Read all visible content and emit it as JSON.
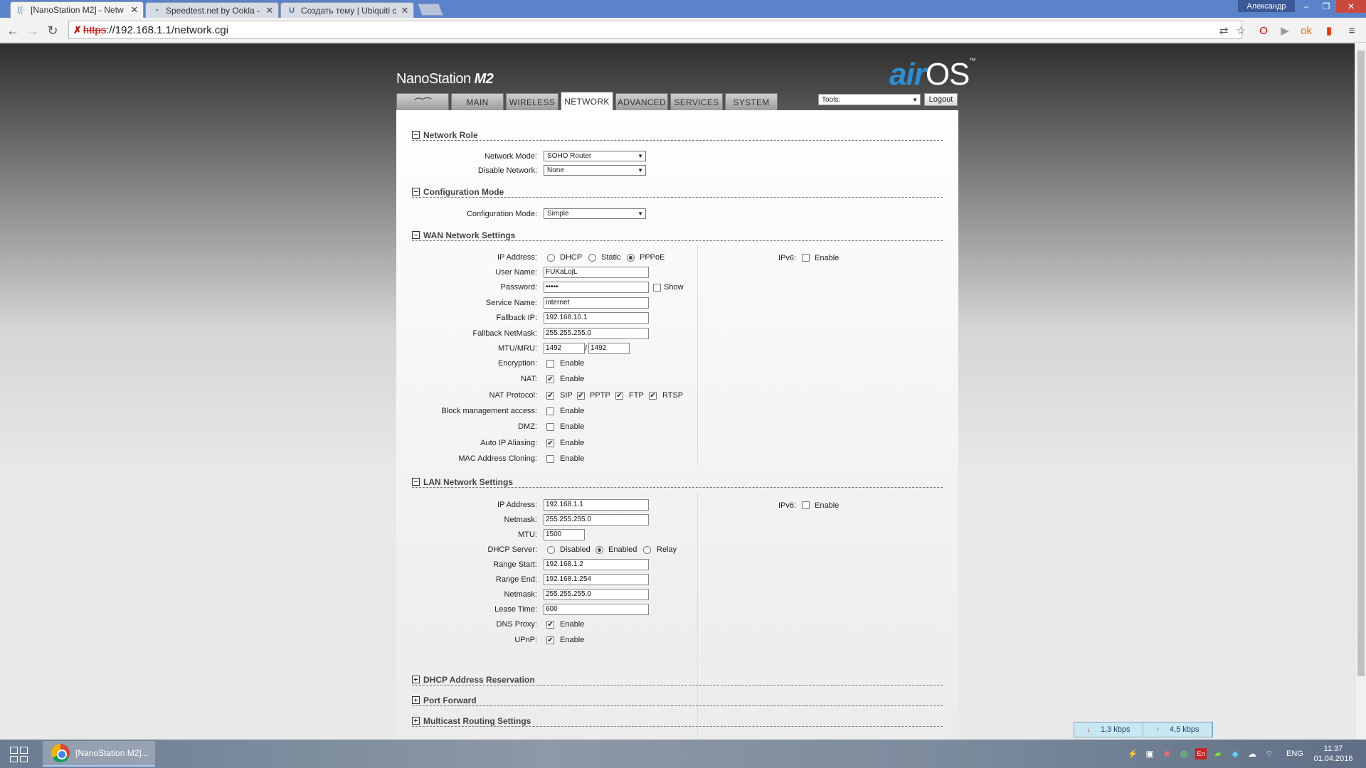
{
  "browser": {
    "tabs": [
      {
        "label": "[NanoStation M2] - Netw",
        "icon": "wifi-icon",
        "active": true
      },
      {
        "label": "Speedtest.net by Ookla -",
        "icon": "speedometer-icon",
        "active": false
      },
      {
        "label": "Создать тему | Ubiquiti c",
        "icon": "ubiquiti-u-icon",
        "active": false
      }
    ],
    "tab_close": "✕",
    "window_user": "Александр",
    "url_scheme": "https",
    "url_rest": "://192.168.1.1/network.cgi"
  },
  "header": {
    "device_name": "NanoStation",
    "device_model": "M2",
    "logo_air": "air",
    "logo_os": "OS",
    "logo_tm": "™",
    "nav": [
      {
        "label": "",
        "icon": "ubiquiti-logo-icon"
      },
      {
        "label": "MAIN"
      },
      {
        "label": "WIRELESS"
      },
      {
        "label": "NETWORK",
        "active": true
      },
      {
        "label": "ADVANCED"
      },
      {
        "label": "SERVICES"
      },
      {
        "label": "SYSTEM"
      }
    ],
    "tools_value": "Tools:",
    "logout_label": "Logout"
  },
  "network_role": {
    "title": "Network Role",
    "network_mode_label": "Network Mode:",
    "network_mode_value": "SOHO Router",
    "disable_network_label": "Disable Network:",
    "disable_network_value": "None"
  },
  "config_mode": {
    "title": "Configuration Mode",
    "label": "Configuration Mode:",
    "value": "Simple"
  },
  "wan": {
    "title": "WAN Network Settings",
    "ip_label": "IP Address:",
    "ip_options": [
      "DHCP",
      "Static",
      "PPPoE"
    ],
    "ip_selected": "PPPoE",
    "ipv6_label": "IPv6:",
    "ipv6_enable": "Enable",
    "username_label": "User Name:",
    "username_value": "FUKaLojL",
    "password_label": "Password:",
    "password_value": "•••••",
    "show_label": "Show",
    "service_label": "Service Name:",
    "service_value": "internet",
    "fallback_ip_label": "Fallback IP:",
    "fallback_ip_value": "192.168.10.1",
    "fallback_mask_label": "Fallback NetMask:",
    "fallback_mask_value": "255.255.255.0",
    "mtu_label": "MTU/MRU:",
    "mtu_value": "1492",
    "mtu_sep": "/",
    "mru_value": "1492",
    "encryption_label": "Encryption:",
    "nat_label": "NAT:",
    "nat_protocol_label": "NAT Protocol:",
    "nat_protocols": [
      "SIP",
      "PPTP",
      "FTP",
      "RTSP"
    ],
    "block_mgmt_label": "Block management access:",
    "dmz_label": "DMZ:",
    "auto_ip_label": "Auto IP Aliasing:",
    "mac_clone_label": "MAC Address Cloning:",
    "enable": "Enable"
  },
  "lan": {
    "title": "LAN Network Settings",
    "ip_label": "IP Address:",
    "ip_value": "192.168.1.1",
    "ipv6_label": "IPv6:",
    "ipv6_enable": "Enable",
    "netmask_label": "Netmask:",
    "netmask_value": "255.255.255.0",
    "mtu_label": "MTU:",
    "mtu_value": "1500",
    "dhcp_label": "DHCP Server:",
    "dhcp_options": [
      "Disabled",
      "Enabled",
      "Relay"
    ],
    "dhcp_selected": "Enabled",
    "range_start_label": "Range Start:",
    "range_start_value": "192.168.1.2",
    "range_end_label": "Range End:",
    "range_end_value": "192.168.1.254",
    "dhcp_netmask_label": "Netmask:",
    "dhcp_netmask_value": "255.255.255.0",
    "lease_label": "Lease Time:",
    "lease_value": "600",
    "dns_proxy_label": "DNS Proxy:",
    "upnp_label": "UPnP:",
    "enable": "Enable"
  },
  "collapsed_sections": [
    "DHCP Address Reservation",
    "Port Forward",
    "Multicast Routing Settings"
  ],
  "netmeter": {
    "down": "1,3 kbps",
    "up": "4,5 kbps"
  },
  "taskbar": {
    "task_label": "[NanoStation M2]...",
    "lang": "ENG",
    "time": "11:37",
    "date": "01.04.2016"
  }
}
